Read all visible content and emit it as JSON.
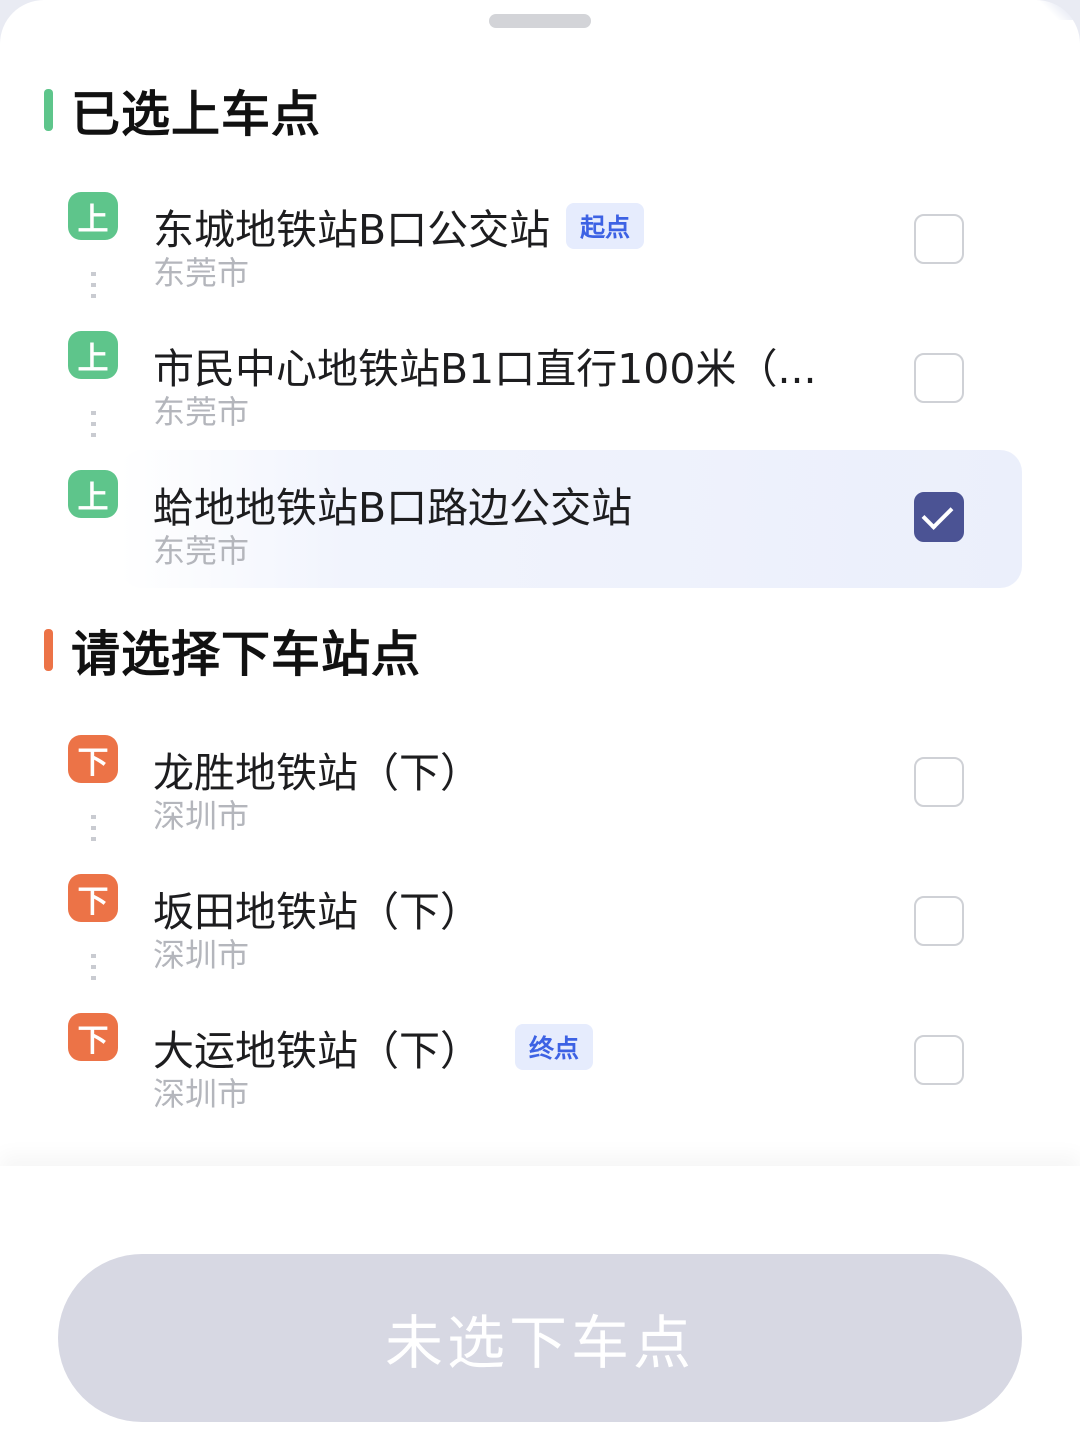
{
  "sections": {
    "pickup": {
      "title": "已选上车点",
      "accent": "#5ec58b"
    },
    "dropoff": {
      "title": "请选择下车站点",
      "accent": "#ec7347"
    }
  },
  "pickup_stops": [
    {
      "icon": "上",
      "name": "东城地铁站B口公交站",
      "tag": "起点",
      "city": "东莞市",
      "checked": false
    },
    {
      "icon": "上",
      "name": "市民中心地铁站B1口直行100米（...",
      "tag": "",
      "city": "东莞市",
      "checked": false
    },
    {
      "icon": "上",
      "name": "蛤地地铁站B口路边公交站",
      "tag": "",
      "city": "东莞市",
      "checked": true
    }
  ],
  "dropoff_stops": [
    {
      "icon": "下",
      "name": "龙胜地铁站（下）",
      "tag": "",
      "city": "深圳市",
      "checked": false
    },
    {
      "icon": "下",
      "name": "坂田地铁站（下）",
      "tag": "",
      "city": "深圳市",
      "checked": false
    },
    {
      "icon": "下",
      "name": "大运地铁站（下）",
      "tag": "终点",
      "city": "深圳市",
      "checked": false
    }
  ],
  "footer": {
    "button_label": "未选下车点"
  },
  "colors": {
    "checked": "#4b5394",
    "tag_text": "#3d62e4",
    "button_disabled": "#d7d8e3"
  }
}
